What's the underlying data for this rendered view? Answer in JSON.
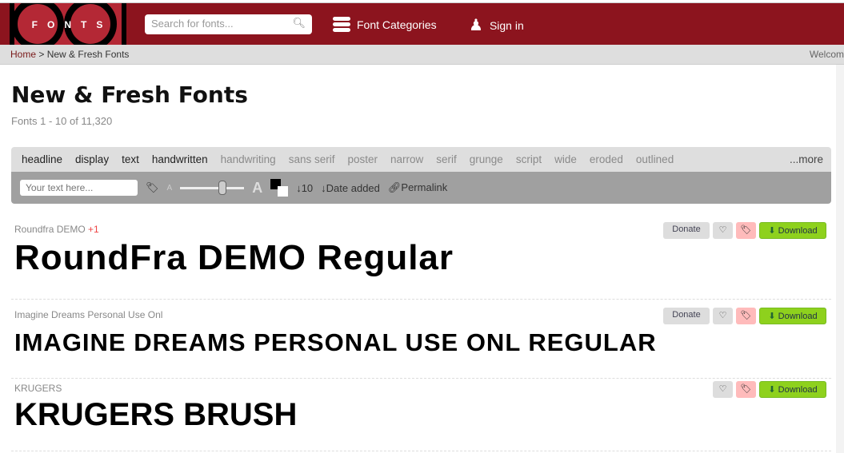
{
  "header": {
    "logo_text": "FONTS",
    "search_placeholder": "Search for fonts...",
    "categories": "Font Categories",
    "signin": "Sign in"
  },
  "breadcrumb": {
    "home": "Home",
    "sep": ">",
    "current": "New & Fresh Fonts",
    "welcome": "Welcom"
  },
  "page": {
    "title": "New & Fresh Fonts",
    "count": "Fonts 1 - 10 of 11,320"
  },
  "categories": [
    {
      "label": "headline",
      "active": true
    },
    {
      "label": "display",
      "active": true
    },
    {
      "label": "text",
      "active": true
    },
    {
      "label": "handwritten",
      "active": true
    },
    {
      "label": "handwriting",
      "active": false
    },
    {
      "label": "sans serif",
      "active": false
    },
    {
      "label": "poster",
      "active": false
    },
    {
      "label": "narrow",
      "active": false
    },
    {
      "label": "serif",
      "active": false
    },
    {
      "label": "grunge",
      "active": false
    },
    {
      "label": "script",
      "active": false
    },
    {
      "label": "wide",
      "active": false
    },
    {
      "label": "eroded",
      "active": false
    },
    {
      "label": "outlined",
      "active": false
    }
  ],
  "more": "...more",
  "tools": {
    "text_placeholder": "Your text here...",
    "small_a": "A",
    "big_a": "A",
    "per_page": "↓10",
    "sort": "↓Date added",
    "permalink": "Permalink"
  },
  "buttons": {
    "donate": "Donate",
    "download": "Download"
  },
  "fonts": [
    {
      "name": "Roundfra DEMO",
      "extra": "+1",
      "preview": "RoundFra DEMO Regular",
      "donate": true
    },
    {
      "name": "Imagine Dreams Personal Use Onl",
      "extra": "",
      "preview": "IMAGINE DREAMS PERSONAL USE ONL REGULAR",
      "donate": true
    },
    {
      "name": "KRUGERS",
      "extra": "",
      "preview": "KRUGERS BRUSH",
      "donate": false
    }
  ]
}
